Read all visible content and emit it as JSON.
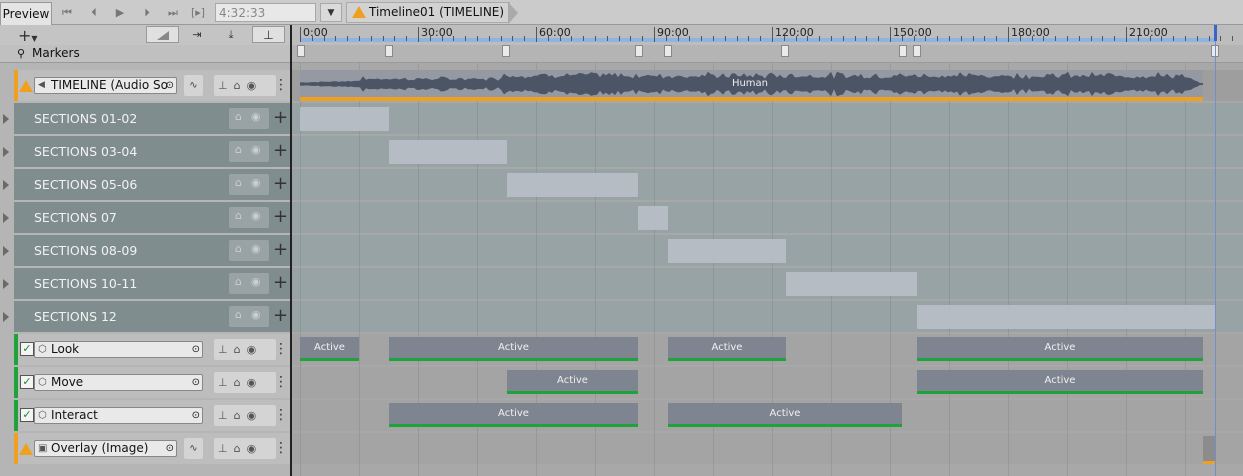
{
  "toolbar": {
    "tab": "Preview",
    "time": "4:32:33",
    "breadcrumb": "Timeline01 (TIMELINE)",
    "buttons": [
      "go-first",
      "prev-frame",
      "play",
      "next-frame",
      "go-last",
      "range"
    ],
    "icons": {
      "add": "+",
      "frame_bracket": "[▸]"
    }
  },
  "ruler": {
    "ticks": [
      "0:00",
      "30:00",
      "60:00",
      "90:00",
      "120:00",
      "150:00",
      "180:00",
      "210:00"
    ]
  },
  "markers_label": "Markers",
  "tracks": {
    "audio": {
      "name": "TIMELINE (Audio So",
      "clip_label": "Human",
      "accent": "#f0a020"
    },
    "sections": [
      {
        "label": "SECTIONS 01-02"
      },
      {
        "label": "SECTIONS 03-04"
      },
      {
        "label": "SECTIONS 05-06"
      },
      {
        "label": "SECTIONS 07"
      },
      {
        "label": "SECTIONS 08-09"
      },
      {
        "label": "SECTIONS 10-11"
      },
      {
        "label": "SECTIONS 12"
      }
    ],
    "activation": [
      {
        "name": "Look",
        "checked": true,
        "clips": [
          "Active",
          "Active",
          "Active",
          "Active"
        ]
      },
      {
        "name": "Move",
        "checked": true,
        "clips": [
          "Active",
          "Active"
        ]
      },
      {
        "name": "Interact",
        "checked": true,
        "clips": [
          "Active",
          "Active"
        ]
      }
    ],
    "overlay": {
      "name": "Overlay (Image)",
      "accent": "#f0a020"
    }
  },
  "colors": {
    "activation_bar": "#1ea33a",
    "audio_accent": "#f0a020",
    "playhead": "#3a64c8"
  }
}
